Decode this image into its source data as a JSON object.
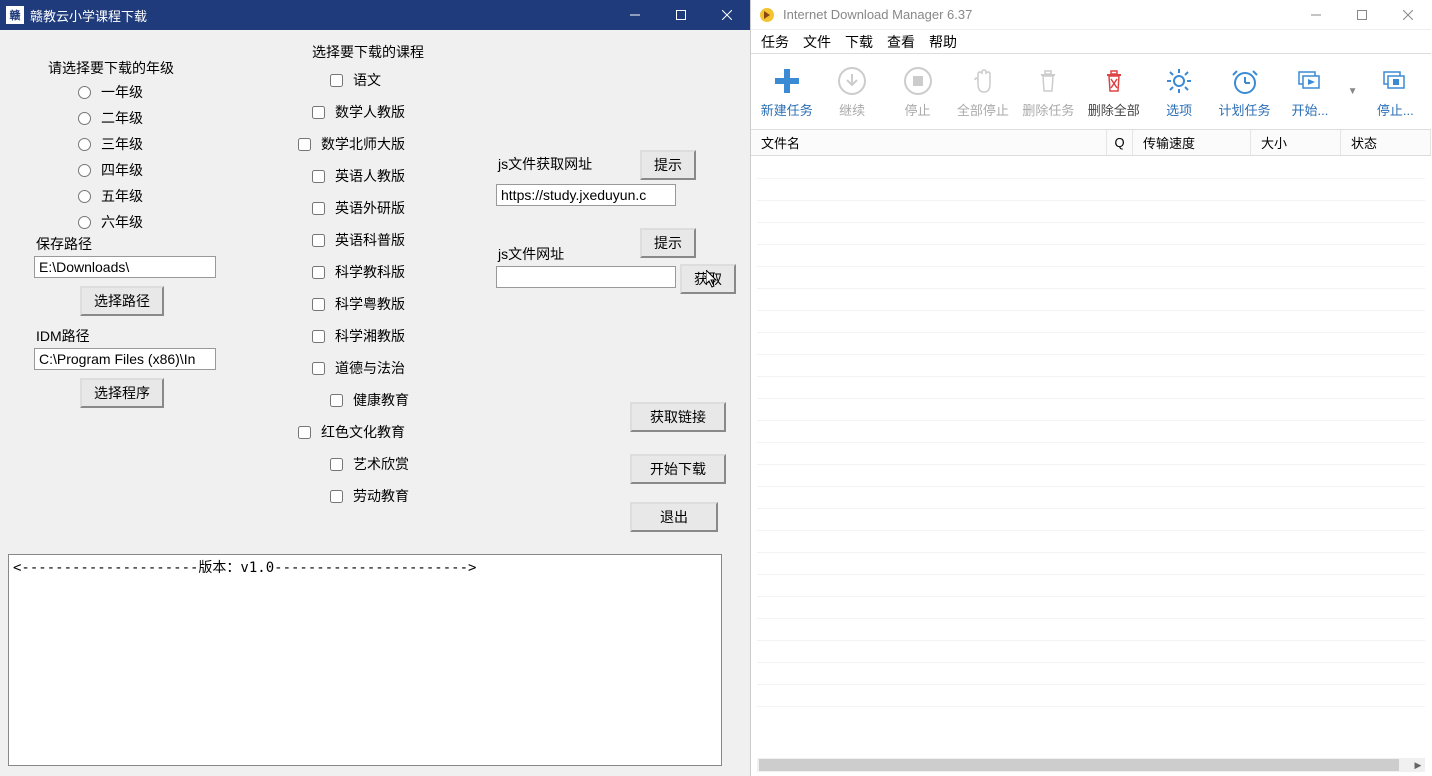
{
  "left": {
    "title": "赣教云小学课程下载",
    "grade_label": "请选择要下载的年级",
    "grades": [
      "一年级",
      "二年级",
      "三年级",
      "四年级",
      "五年级",
      "六年级"
    ],
    "save_path_label": "保存路径",
    "save_path_value": "E:\\Downloads\\",
    "btn_choose_path": "选择路径",
    "idm_path_label": "IDM路径",
    "idm_path_value": "C:\\Program Files (x86)\\In",
    "btn_choose_prog": "选择程序",
    "course_label": "选择要下载的课程",
    "courses": [
      {
        "label": "语文",
        "indent": true
      },
      {
        "label": "数学人教版",
        "indent": false
      },
      {
        "label": "数学北师大版",
        "indent": false,
        "outdent": true
      },
      {
        "label": "英语人教版",
        "indent": false
      },
      {
        "label": "英语外研版",
        "indent": false
      },
      {
        "label": "英语科普版",
        "indent": false
      },
      {
        "label": "科学教科版",
        "indent": false
      },
      {
        "label": "科学粤教版",
        "indent": false
      },
      {
        "label": "科学湘教版",
        "indent": false
      },
      {
        "label": "道德与法治",
        "indent": false
      },
      {
        "label": "健康教育",
        "indent": true
      },
      {
        "label": "红色文化教育",
        "indent": false,
        "outdent": true
      },
      {
        "label": "艺术欣赏",
        "indent": true
      },
      {
        "label": "劳动教育",
        "indent": true
      }
    ],
    "js_url_label1": "js文件获取网址",
    "btn_tip": "提示",
    "url1_value": "https://study.jxeduyun.c",
    "js_url_label2": "js文件网址",
    "url2_value": "",
    "btn_fetch": "获取",
    "btn_get_links": "获取链接",
    "btn_start_dl": "开始下载",
    "btn_exit": "退出",
    "log_text": "<---------------------版本：v1.0----------------------->"
  },
  "right": {
    "title": "Internet Download Manager 6.37",
    "menu": [
      "任务",
      "文件",
      "下载",
      "查看",
      "帮助"
    ],
    "toolbar": [
      {
        "label": "新建任务",
        "icon": "plus",
        "state": "blue"
      },
      {
        "label": "继续",
        "icon": "down",
        "state": "disabled"
      },
      {
        "label": "停止",
        "icon": "stop",
        "state": "disabled"
      },
      {
        "label": "全部停止",
        "icon": "hand",
        "state": "disabled"
      },
      {
        "label": "删除任务",
        "icon": "trash",
        "state": "disabled"
      },
      {
        "label": "删除全部",
        "icon": "trash-x",
        "state": "black"
      },
      {
        "label": "选项",
        "icon": "gear",
        "state": "blue"
      },
      {
        "label": "计划任务",
        "icon": "clock",
        "state": "blue"
      },
      {
        "label": "开始...",
        "icon": "queue-start",
        "state": "blue"
      },
      {
        "label": "停止...",
        "icon": "queue-stop",
        "state": "blue"
      }
    ],
    "columns": {
      "file": "文件名",
      "q": "Q",
      "speed": "传输速度",
      "size": "大小",
      "status": "状态"
    }
  }
}
